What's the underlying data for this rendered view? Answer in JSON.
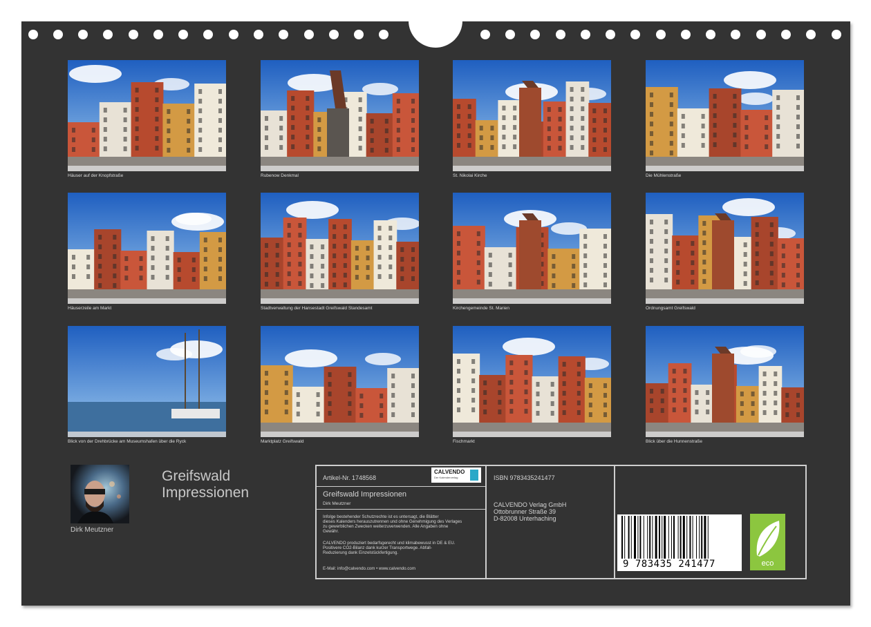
{
  "photos": [
    {
      "caption": "Häuser auf der Knopfstraße"
    },
    {
      "caption": "Rubenow Denkmal"
    },
    {
      "caption": "St. Nikolai Kirche"
    },
    {
      "caption": "Die Mühlenstraße"
    },
    {
      "caption": "Häuserzeile am Markt"
    },
    {
      "caption": "Stadtverwaltung der Hansestadt Greifswald Standesamt"
    },
    {
      "caption": "Kirchengemeinde St. Marien"
    },
    {
      "caption": "Ordnungsamt Greifswald"
    },
    {
      "caption": "Blick von der Drehbrücke am Museumshafen über die Ryck"
    },
    {
      "caption": "Marktplatz Greifswald"
    },
    {
      "caption": "Fischmarkt"
    },
    {
      "caption": "Blick über die Hunnenstraße"
    }
  ],
  "calendar": {
    "title_line1": "Greifswald",
    "title_line2": "Impressionen",
    "author": "Dirk Meutzner"
  },
  "info": {
    "article": "Artikel-Nr. 1748568",
    "logo_text": "CALVENDO",
    "logo_sub": "Der Kalenderverlag",
    "title": "Greifswald Impressionen",
    "author": "Dirk Meutzner",
    "legal": [
      "Infolge bestehender Schutzrechte ist es untersagt, die Blätter",
      "dieses Kalenders herauszutrennen und ohne Genehmigung des Verlages",
      "zu gewerblichen Zwecken weiterzuverwenden. Alle Angaben ohne",
      "Gewähr."
    ],
    "eco_text": [
      "CALVENDO produziert bedarfsgerecht und klimabewusst in DE & EU.",
      "Positivere CO2-Bilanz dank kurzer Transportwege. Abfall-",
      "Reduzierung dank Einzelstückfertigung."
    ],
    "contact": "E-Mail: info@calvendo.com • www.calvendo.com",
    "isbn": "ISBN 9783435241477",
    "publisher": [
      "CALVENDO Verlag GmbH",
      "Ottobrunner Straße 39",
      "D-82008 Unterhaching"
    ],
    "barcode_digits": "9 783435 241477",
    "eco_label": "eco"
  },
  "colors": {
    "page": "#333333",
    "hole": "#ffffff",
    "border": "#cfcfcf",
    "eco": "#8cc63f",
    "sky": "#2f7fd6"
  }
}
